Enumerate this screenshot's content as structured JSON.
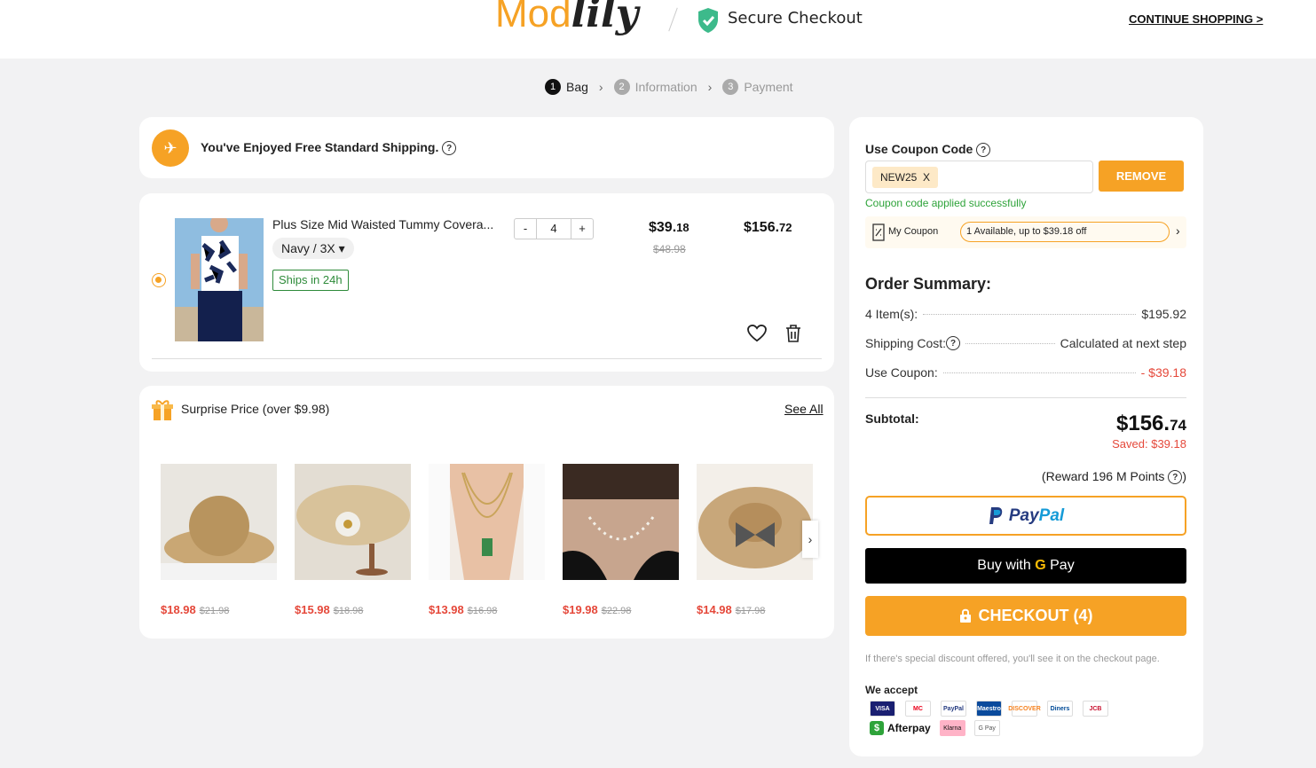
{
  "header": {
    "logo_a": "Mod",
    "logo_b": "lily",
    "secure_checkout": "Secure Checkout",
    "continue_shopping": "CONTINUE SHOPPING >"
  },
  "steps": [
    {
      "num": "1",
      "label": "Bag"
    },
    {
      "num": "2",
      "label": "Information"
    },
    {
      "num": "3",
      "label": "Payment"
    }
  ],
  "shipping_banner": {
    "text": "You've Enjoyed Free Standard Shipping."
  },
  "cart_item": {
    "name": "Plus Size Mid Waisted Tummy Covera...",
    "variant": "Navy / 3X",
    "badge": "Ships in 24h",
    "qty_minus": "-",
    "qty": "4",
    "qty_plus": "+",
    "price_main": "$39.",
    "price_cents": "18",
    "orig_price": "$48.98",
    "total_main": "$156.",
    "total_cents": "72"
  },
  "surprise": {
    "title": "Surprise Price (over $9.98)",
    "see_all": "See All",
    "items": [
      {
        "price": "$18.98",
        "orig": "$21.98"
      },
      {
        "price": "$15.98",
        "orig": "$18.98"
      },
      {
        "price": "$13.98",
        "orig": "$16.98"
      },
      {
        "price": "$19.98",
        "orig": "$22.98"
      },
      {
        "price": "$14.98",
        "orig": "$17.98"
      }
    ]
  },
  "coupon": {
    "title": "Use Coupon Code",
    "code": "NEW25",
    "remove_x": "X",
    "remove_btn": "REMOVE",
    "applied": "Coupon code applied successfully",
    "my_coupon": "My Coupon",
    "available": "1 Available, up to $39.18 off"
  },
  "summary": {
    "title": "Order Summary:",
    "items_label": "4 Item(s):",
    "items_value": "$195.92",
    "shipping_label": "Shipping Cost:",
    "shipping_value": "Calculated at next step",
    "coupon_label": "Use Coupon:",
    "coupon_value": "- $39.18",
    "subtotal_label": "Subtotal:",
    "subtotal_main": "$156.",
    "subtotal_cents": "74",
    "saved": "Saved: $39.18",
    "reward": "(Reward 196 M Points"
  },
  "payment": {
    "paypal_a": "Pay",
    "paypal_b": "Pal",
    "gpay_prefix": "Buy with",
    "gpay_g": "G",
    "gpay_suffix": "Pay",
    "checkout": "CHECKOUT (4)",
    "disclaimer": "If there's special discount offered, you'll see it on the checkout page.",
    "we_accept": "We accept",
    "cards": [
      "VISA",
      "MC",
      "PayPal",
      "Maestro",
      "DISCOVER",
      "Diners",
      "JCB"
    ],
    "afterpay": "Afterpay",
    "klarna": "Klarna",
    "gpay_small": "G Pay"
  },
  "colors": {
    "accent": "#f6a225",
    "red": "#e5483a",
    "green": "#2ea33a"
  }
}
